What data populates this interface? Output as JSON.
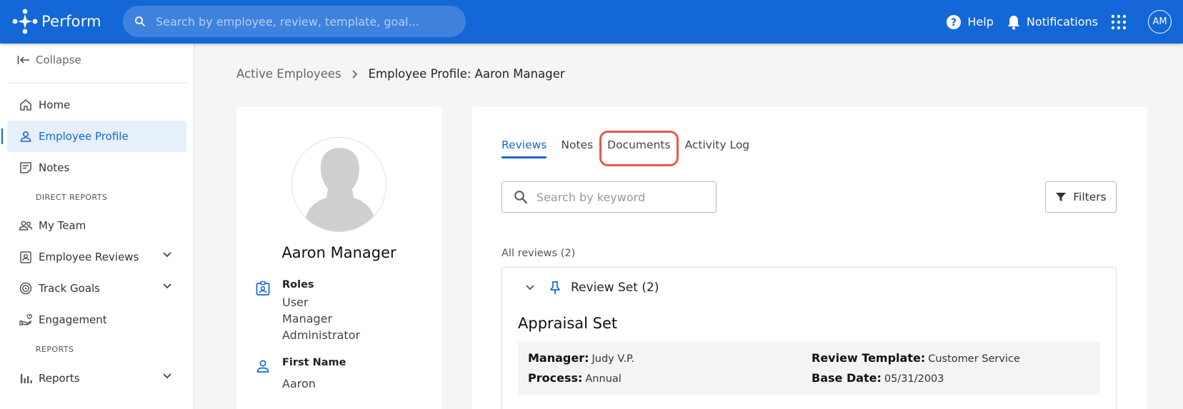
{
  "topbar": {
    "brand": "Perform",
    "search_placeholder": "Search by employee, review, template, goal...",
    "help_label": "Help",
    "notifications_label": "Notifications",
    "avatar_initials": "AM",
    "accent_color": "#1467d6"
  },
  "sidebar": {
    "collapse_label": "Collapse",
    "items": [
      {
        "label": "Home",
        "icon": "home-icon"
      },
      {
        "label": "Employee Profile",
        "icon": "person-icon",
        "active": true
      },
      {
        "label": "Notes",
        "icon": "notes-icon"
      }
    ],
    "section_direct_reports": "DIRECT REPORTS",
    "direct_items": [
      {
        "label": "My Team",
        "icon": "team-icon"
      },
      {
        "label": "Employee Reviews",
        "icon": "badge-icon",
        "expandable": true
      },
      {
        "label": "Track Goals",
        "icon": "target-icon",
        "expandable": true
      },
      {
        "label": "Engagement",
        "icon": "engagement-icon"
      }
    ],
    "section_reports": "REPORTS",
    "report_items": [
      {
        "label": "Reports",
        "icon": "bar-chart-icon",
        "expandable": true
      }
    ]
  },
  "breadcrumb": {
    "parent": "Active Employees",
    "current": "Employee Profile: Aaron Manager"
  },
  "profile": {
    "name": "Aaron Manager",
    "roles_label": "Roles",
    "roles": [
      "User",
      "Manager",
      "Administrator"
    ],
    "first_name_label": "First Name",
    "first_name": "Aaron"
  },
  "main": {
    "tabs": [
      {
        "label": "Reviews",
        "active": true
      },
      {
        "label": "Notes"
      },
      {
        "label": "Documents",
        "highlighted": true
      },
      {
        "label": "Activity Log"
      }
    ],
    "search_placeholder": "Search by keyword",
    "filters_label": "Filters",
    "all_reviews_label": "All reviews (2)",
    "review_set_label": "Review Set (2)",
    "appraisal_title": "Appraisal Set",
    "details": {
      "manager_label": "Manager:",
      "manager_value": "Judy V.P.",
      "process_label": "Process:",
      "process_value": "Annual",
      "template_label": "Review Template:",
      "template_value": "Customer Service",
      "base_date_label": "Base Date:",
      "base_date_value": "05/31/2003"
    },
    "highlight_color": "#e8584c"
  }
}
